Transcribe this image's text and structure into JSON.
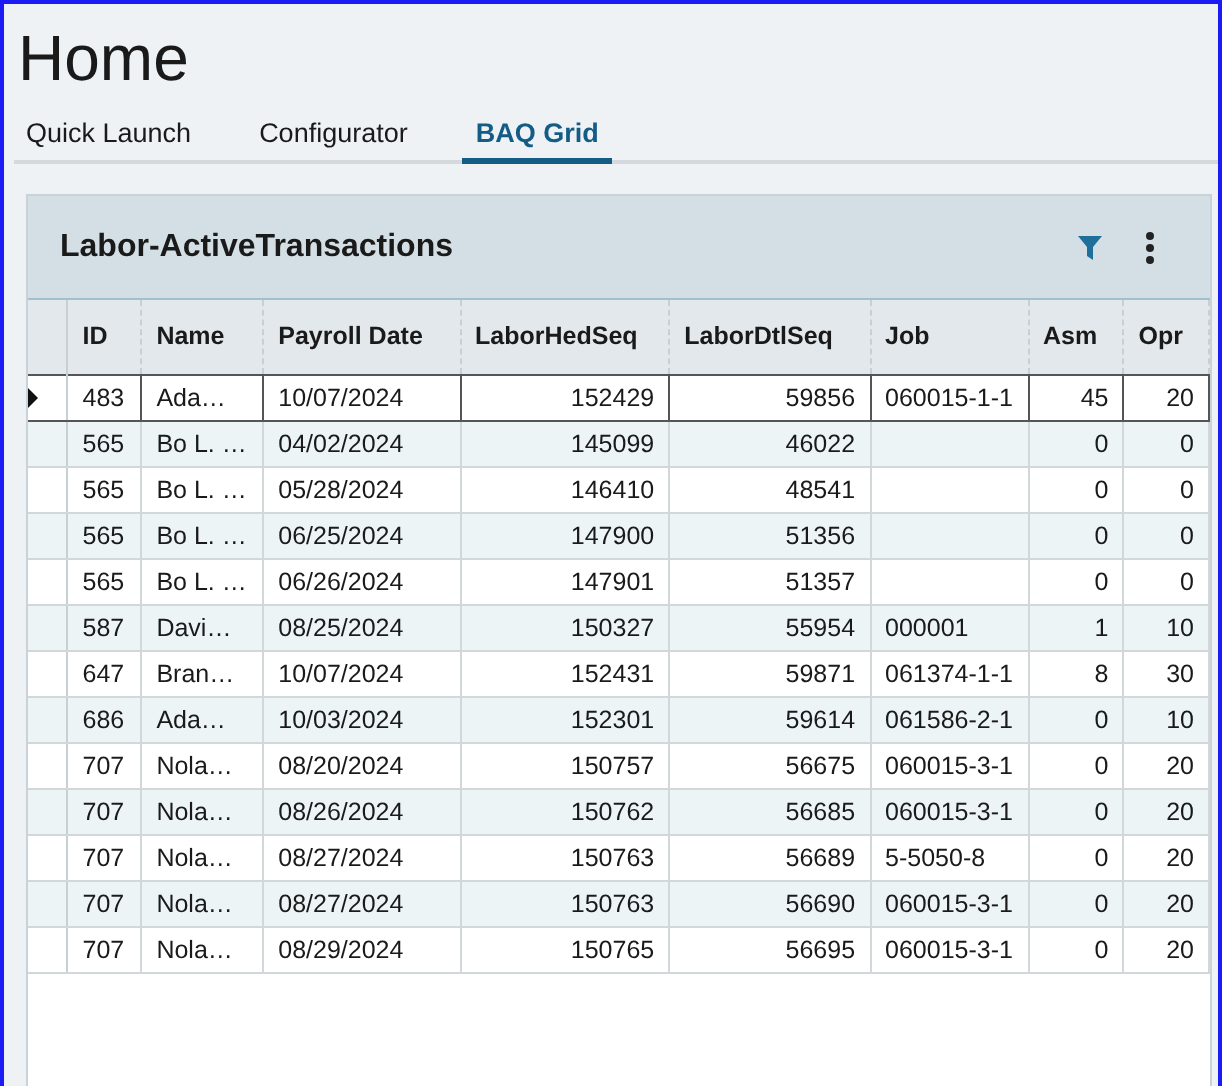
{
  "page": {
    "title": "Home"
  },
  "tabs": [
    {
      "label": "Quick Launch",
      "selected": false
    },
    {
      "label": "Configurator",
      "selected": false
    },
    {
      "label": "BAQ Grid",
      "selected": true
    }
  ],
  "grid": {
    "title": "Labor-ActiveTransactions",
    "columns": [
      "ID",
      "Name",
      "Payroll Date",
      "LaborHedSeq",
      "LaborDtlSeq",
      "Job",
      "Asm",
      "Opr"
    ],
    "rows": [
      {
        "selected": true,
        "id": "483",
        "name": "Ada…",
        "payroll_date": "10/07/2024",
        "labor_hed_seq": "152429",
        "labor_dtl_seq": "59856",
        "job": "060015-1-1",
        "asm": "45",
        "opr": "20"
      },
      {
        "selected": false,
        "id": "565",
        "name": "Bo L. …",
        "payroll_date": "04/02/2024",
        "labor_hed_seq": "145099",
        "labor_dtl_seq": "46022",
        "asm": "0",
        "opr": "0"
      },
      {
        "selected": false,
        "id": "565",
        "name": "Bo L. …",
        "payroll_date": "05/28/2024",
        "labor_hed_seq": "146410",
        "labor_dtl_seq": "48541",
        "asm": "0",
        "opr": "0"
      },
      {
        "selected": false,
        "id": "565",
        "name": "Bo L. …",
        "payroll_date": "06/25/2024",
        "labor_hed_seq": "147900",
        "labor_dtl_seq": "51356",
        "asm": "0",
        "opr": "0"
      },
      {
        "selected": false,
        "id": "565",
        "name": "Bo L. …",
        "payroll_date": "06/26/2024",
        "labor_hed_seq": "147901",
        "labor_dtl_seq": "51357",
        "asm": "0",
        "opr": "0"
      },
      {
        "selected": false,
        "id": "587",
        "name": "Davi…",
        "payroll_date": "08/25/2024",
        "labor_hed_seq": "150327",
        "labor_dtl_seq": "55954",
        "job": "000001",
        "asm": "1",
        "opr": "10"
      },
      {
        "selected": false,
        "id": "647",
        "name": "Bran…",
        "payroll_date": "10/07/2024",
        "labor_hed_seq": "152431",
        "labor_dtl_seq": "59871",
        "job": "061374-1-1",
        "asm": "8",
        "opr": "30"
      },
      {
        "selected": false,
        "id": "686",
        "name": "Ada…",
        "payroll_date": "10/03/2024",
        "labor_hed_seq": "152301",
        "labor_dtl_seq": "59614",
        "job": "061586-2-1",
        "asm": "0",
        "opr": "10"
      },
      {
        "selected": false,
        "id": "707",
        "name": "Nola…",
        "payroll_date": "08/20/2024",
        "labor_hed_seq": "150757",
        "labor_dtl_seq": "56675",
        "job": "060015-3-1",
        "asm": "0",
        "opr": "20"
      },
      {
        "selected": false,
        "id": "707",
        "name": "Nola…",
        "payroll_date": "08/26/2024",
        "labor_hed_seq": "150762",
        "labor_dtl_seq": "56685",
        "job": "060015-3-1",
        "asm": "0",
        "opr": "20"
      },
      {
        "selected": false,
        "id": "707",
        "name": "Nola…",
        "payroll_date": "08/27/2024",
        "labor_hed_seq": "150763",
        "labor_dtl_seq": "56689",
        "job": "5-5050-8",
        "asm": "0",
        "opr": "20"
      },
      {
        "selected": false,
        "id": "707",
        "name": "Nola…",
        "payroll_date": "08/27/2024",
        "labor_hed_seq": "150763",
        "labor_dtl_seq": "56690",
        "job": "060015-3-1",
        "asm": "0",
        "opr": "20"
      },
      {
        "selected": false,
        "id": "707",
        "name": "Nola…",
        "payroll_date": "08/29/2024",
        "labor_hed_seq": "150765",
        "labor_dtl_seq": "56695",
        "job": "060015-3-1",
        "asm": "0",
        "opr": "20"
      }
    ]
  }
}
